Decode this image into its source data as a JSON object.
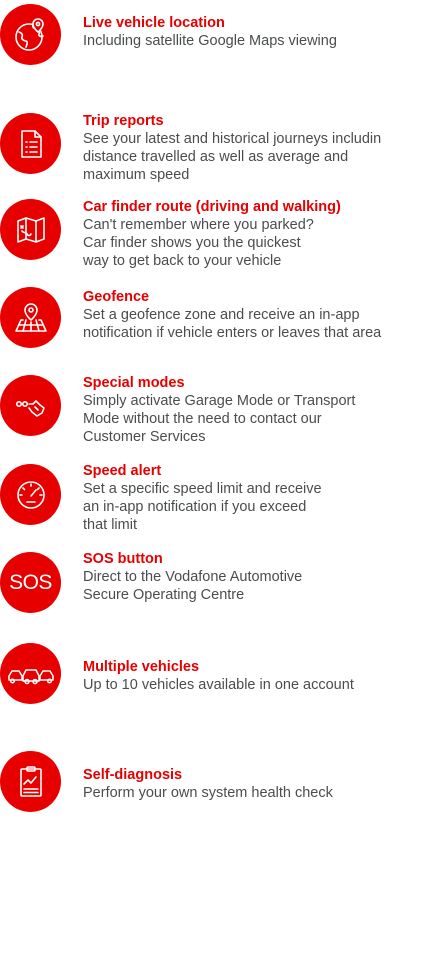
{
  "brand": {
    "accent_color": "#e60000",
    "text_color": "#4a4d4e"
  },
  "features": [
    {
      "icon": "globe-location-icon",
      "title": "Live vehicle location",
      "description": [
        "Including satellite Google Maps viewing"
      ]
    },
    {
      "icon": "document-list-icon",
      "title": "Trip reports",
      "description": [
        "See your latest and historical journeys includin",
        "distance travelled as well as average and",
        "maximum speed"
      ]
    },
    {
      "icon": "map-icon",
      "title": "Car finder route (driving and walking)",
      "description": [
        "Can't remember where you parked?",
        "Car finder shows you the quickest",
        "way to get back to your vehicle"
      ]
    },
    {
      "icon": "geofence-pin-icon",
      "title": "Geofence",
      "description": [
        "Set a geofence zone and receive an in-app",
        "notification if vehicle enters or leaves that area"
      ]
    },
    {
      "icon": "key-icon",
      "title": "Special modes",
      "description": [
        "Simply activate Garage Mode or Transport",
        "Mode without the need to contact our",
        "Customer Services"
      ]
    },
    {
      "icon": "speedometer-icon",
      "title": "Speed alert",
      "description": [
        "Set a specific speed limit and receive",
        "an in-app notification if you exceed",
        "that limit"
      ]
    },
    {
      "icon": "sos-icon",
      "icon_text": "SOS",
      "title": "SOS button",
      "description": [
        "Direct to the Vodafone Automotive",
        "Secure Operating Centre"
      ]
    },
    {
      "icon": "multiple-cars-icon",
      "title": "Multiple vehicles",
      "description": [
        "Up to 10 vehicles available in one account"
      ]
    },
    {
      "icon": "clipboard-diagnosis-icon",
      "title": "Self-diagnosis",
      "description": [
        "Perform your own system health check"
      ]
    }
  ]
}
